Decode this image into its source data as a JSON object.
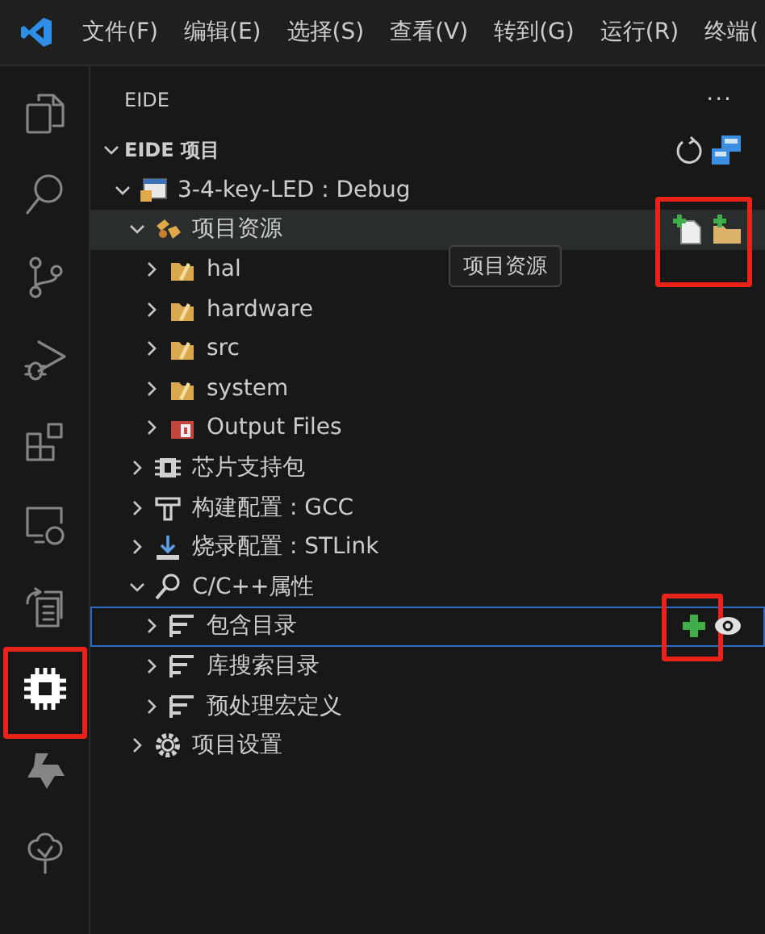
{
  "menu_bar": {
    "items": [
      "文件(F)",
      "编辑(E)",
      "选择(S)",
      "查看(V)",
      "转到(G)",
      "运行(R)",
      "终端("
    ]
  },
  "activity_bar": {
    "items": [
      {
        "kind": "explorer",
        "selected": false,
        "marked": false
      },
      {
        "kind": "search",
        "selected": false,
        "marked": false
      },
      {
        "kind": "source-control",
        "selected": false,
        "marked": false
      },
      {
        "kind": "debug",
        "selected": false,
        "marked": false
      },
      {
        "kind": "extensions",
        "selected": false,
        "marked": false
      },
      {
        "kind": "remote",
        "selected": false,
        "marked": false
      },
      {
        "kind": "docs",
        "selected": false,
        "marked": false
      },
      {
        "kind": "chip",
        "selected": true,
        "marked": true
      },
      {
        "kind": "star",
        "selected": false,
        "marked": false
      },
      {
        "kind": "tree",
        "selected": false,
        "marked": false
      }
    ]
  },
  "sidebar": {
    "title": "EIDE",
    "more": "···",
    "section": {
      "title": "EIDE 项目",
      "expanded": true,
      "actions": [
        {
          "kind": "refresh"
        },
        {
          "kind": "switch"
        }
      ],
      "items": [
        {
          "label": "3-4-key-LED : Debug",
          "kind": "project",
          "expanded": true,
          "children": [
            {
              "label": "项目资源",
              "kind": "sources",
              "expanded": true,
              "hovered": true,
              "tooltip": "项目资源",
              "actions_marked": true,
              "actions": [
                {
                  "kind": "add-file",
                  "marked": false
                },
                {
                  "kind": "add-folder",
                  "marked": false
                }
              ],
              "children": [
                {
                  "label": "hal",
                  "kind": "folder",
                  "expanded": false
                },
                {
                  "label": "hardware",
                  "kind": "folder",
                  "expanded": false
                },
                {
                  "label": "src",
                  "kind": "folder",
                  "expanded": false
                },
                {
                  "label": "system",
                  "kind": "folder",
                  "expanded": false
                },
                {
                  "label": "Output Files",
                  "kind": "output",
                  "expanded": false
                }
              ]
            },
            {
              "label": "芯片支持包",
              "kind": "chip",
              "expanded": false
            },
            {
              "label": "构建配置 : GCC",
              "kind": "build",
              "expanded": false
            },
            {
              "label": "烧录配置 : STLink",
              "kind": "flash",
              "expanded": false
            },
            {
              "label": "C/C++属性",
              "kind": "key",
              "expanded": true,
              "children": [
                {
                  "label": "包含目录",
                  "kind": "list",
                  "expanded": false,
                  "focused": true,
                  "actions": [
                    {
                      "kind": "add",
                      "marked": true
                    },
                    {
                      "kind": "view",
                      "marked": false
                    }
                  ]
                },
                {
                  "label": "库搜索目录",
                  "kind": "list",
                  "expanded": false
                },
                {
                  "label": "预处理宏定义",
                  "kind": "list",
                  "expanded": false
                }
              ]
            },
            {
              "label": "项目设置",
              "kind": "settings",
              "expanded": false
            }
          ]
        }
      ]
    }
  }
}
